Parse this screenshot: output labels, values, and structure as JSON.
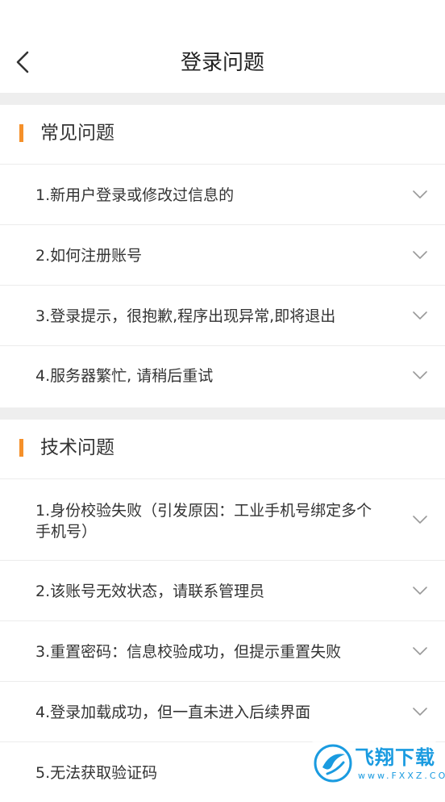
{
  "header": {
    "title": "登录问题",
    "back_icon": "chevron-left-icon"
  },
  "sections": [
    {
      "title": "常见问题",
      "items": [
        "1.新用户登录或修改过信息的",
        "2.如何注册账号",
        "3.登录提示，很抱歉,程序出现异常,即将退出",
        "4.服务器繁忙, 请稍后重试"
      ]
    },
    {
      "title": "技术问题",
      "items": [
        "1.身份校验失败（引发原因：工业手机号绑定多个手机号）",
        "2.该账号无效状态，请联系管理员",
        "3.重置密码：信息校验成功，但提示重置失败",
        "4.登录加载成功，但一直未进入后续界面",
        "5.无法获取验证码"
      ]
    }
  ],
  "watermark": {
    "main": "飞翔下载",
    "sub": "www.FXXZ.COM"
  },
  "colors": {
    "accent": "#f5902a",
    "divider": "#ececec",
    "gap": "#eeeeee",
    "watermark": "#1a9be0"
  }
}
